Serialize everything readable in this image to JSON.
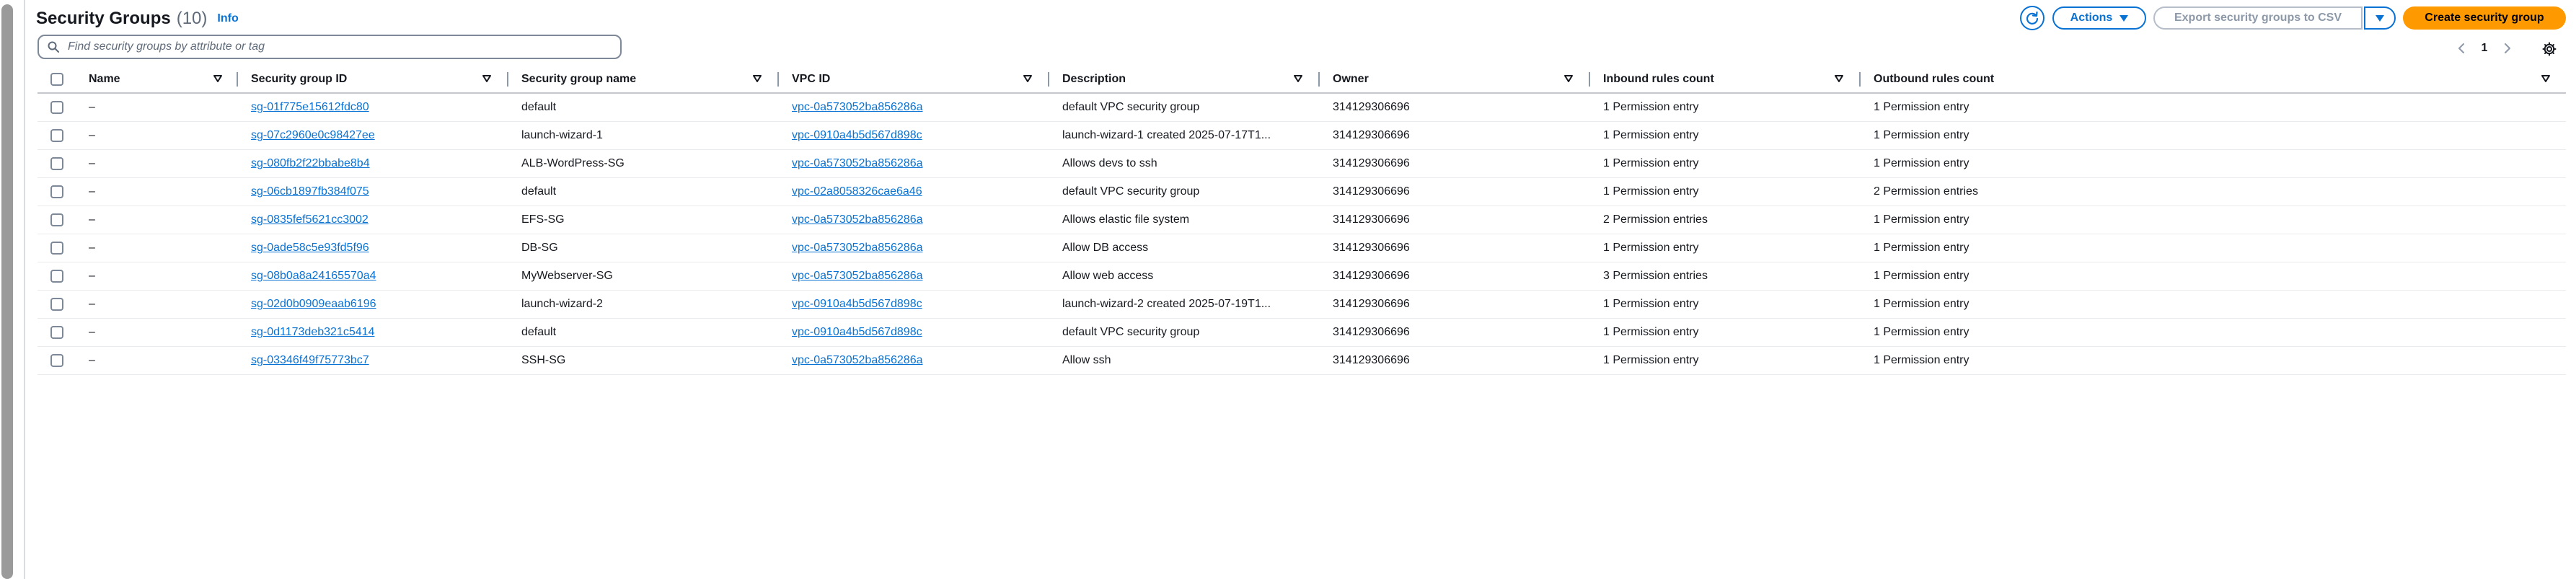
{
  "header": {
    "title": "Security Groups",
    "count": "(10)",
    "info": "Info"
  },
  "toolbar": {
    "actions_label": "Actions",
    "export_label": "Export security groups to CSV",
    "create_label": "Create security group"
  },
  "search": {
    "placeholder": "Find security groups by attribute or tag"
  },
  "pagination": {
    "current_page": "1"
  },
  "table": {
    "columns": [
      "Name",
      "Security group ID",
      "Security group name",
      "VPC ID",
      "Description",
      "Owner",
      "Inbound rules count",
      "Outbound rules count"
    ],
    "rows": [
      {
        "name": "–",
        "sg_id": "sg-01f775e15612fdc80",
        "sg_name": "default",
        "vpc_id": "vpc-0a573052ba856286a",
        "description": "default VPC security group",
        "owner": "314129306696",
        "inbound": "1 Permission entry",
        "outbound": "1 Permission entry"
      },
      {
        "name": "–",
        "sg_id": "sg-07c2960e0c98427ee",
        "sg_name": "launch-wizard-1",
        "vpc_id": "vpc-0910a4b5d567d898c",
        "description": "launch-wizard-1 created 2025-07-17T1...",
        "owner": "314129306696",
        "inbound": "1 Permission entry",
        "outbound": "1 Permission entry"
      },
      {
        "name": "–",
        "sg_id": "sg-080fb2f22bbabe8b4",
        "sg_name": "ALB-WordPress-SG",
        "vpc_id": "vpc-0a573052ba856286a",
        "description": "Allows devs to ssh",
        "owner": "314129306696",
        "inbound": "1 Permission entry",
        "outbound": "1 Permission entry"
      },
      {
        "name": "–",
        "sg_id": "sg-06cb1897fb384f075",
        "sg_name": "default",
        "vpc_id": "vpc-02a8058326cae6a46",
        "description": "default VPC security group",
        "owner": "314129306696",
        "inbound": "1 Permission entry",
        "outbound": "2 Permission entries"
      },
      {
        "name": "–",
        "sg_id": "sg-0835fef5621cc3002",
        "sg_name": "EFS-SG",
        "vpc_id": "vpc-0a573052ba856286a",
        "description": "Allows elastic file system",
        "owner": "314129306696",
        "inbound": "2 Permission entries",
        "outbound": "1 Permission entry"
      },
      {
        "name": "–",
        "sg_id": "sg-0ade58c5e93fd5f96",
        "sg_name": "DB-SG",
        "vpc_id": "vpc-0a573052ba856286a",
        "description": "Allow DB access",
        "owner": "314129306696",
        "inbound": "1 Permission entry",
        "outbound": "1 Permission entry"
      },
      {
        "name": "–",
        "sg_id": "sg-08b0a8a24165570a4",
        "sg_name": "MyWebserver-SG",
        "vpc_id": "vpc-0a573052ba856286a",
        "description": "Allow web access",
        "owner": "314129306696",
        "inbound": "3 Permission entries",
        "outbound": "1 Permission entry"
      },
      {
        "name": "–",
        "sg_id": "sg-02d0b0909eaab6196",
        "sg_name": "launch-wizard-2",
        "vpc_id": "vpc-0910a4b5d567d898c",
        "description": "launch-wizard-2 created 2025-07-19T1...",
        "owner": "314129306696",
        "inbound": "1 Permission entry",
        "outbound": "1 Permission entry"
      },
      {
        "name": "–",
        "sg_id": "sg-0d1173deb321c5414",
        "sg_name": "default",
        "vpc_id": "vpc-0910a4b5d567d898c",
        "description": "default VPC security group",
        "owner": "314129306696",
        "inbound": "1 Permission entry",
        "outbound": "1 Permission entry"
      },
      {
        "name": "–",
        "sg_id": "sg-03346f49f75773bc7",
        "sg_name": "SSH-SG",
        "vpc_id": "vpc-0a573052ba856286a",
        "description": "Allow ssh",
        "owner": "314129306696",
        "inbound": "1 Permission entry",
        "outbound": "1 Permission entry"
      }
    ]
  },
  "icons": {
    "refresh": "refresh-icon",
    "search": "search-icon",
    "caret": "caret-down-icon",
    "sort": "sort-filter-icon",
    "settings": "gear-icon",
    "prev": "chevron-left-icon",
    "next": "chevron-right-icon"
  },
  "colors": {
    "link": "#0972d3",
    "primary_button": "#ff9900",
    "disabled_text": "#8d99a8",
    "text": "#16191f"
  }
}
